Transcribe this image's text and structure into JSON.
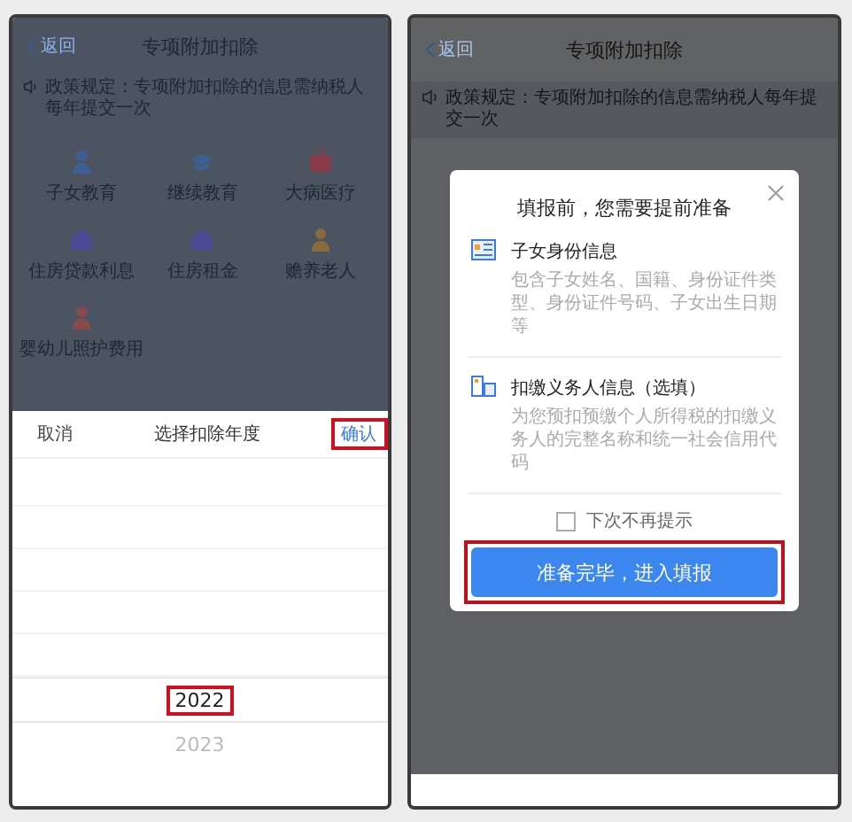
{
  "left_screen": {
    "nav": {
      "back": "返回",
      "title": "专项附加扣除"
    },
    "notice": "政策规定：专项附加扣除的信息需纳税人每年提交一次",
    "categories": [
      "子女教育",
      "继续教育",
      "大病医疗",
      "住房贷款利息",
      "住房租金",
      "赡养老人",
      "婴幼儿照护费用"
    ],
    "year_picker": {
      "cancel": "取消",
      "title": "选择扣除年度",
      "confirm": {
        "label": "确认",
        "highlighted": true
      },
      "years": [
        {
          "label": "2022",
          "selected": true,
          "highlighted": true
        },
        {
          "label": "2023",
          "selected": false,
          "highlighted": false
        }
      ]
    }
  },
  "right_screen": {
    "nav": {
      "back": "返回",
      "title": "专项附加扣除"
    },
    "notice": "政策规定：专项附加扣除的信息需纳税人每年提交一次",
    "dialog": {
      "title": "填报前，您需要提前准备",
      "items": [
        {
          "title": "子女身份信息",
          "description": "包含子女姓名、国籍、身份证件类型、身份证件号码、子女出生日期等"
        },
        {
          "title": "扣缴义务人信息（选填）",
          "description": "为您预扣预缴个人所得税的扣缴义务人的完整名称和统一社会信用代码"
        }
      ],
      "dont_remind": {
        "label": "下次不再提示",
        "checked": false
      },
      "button": {
        "label": "准备完毕，进入填报",
        "highlighted": true
      }
    }
  }
}
